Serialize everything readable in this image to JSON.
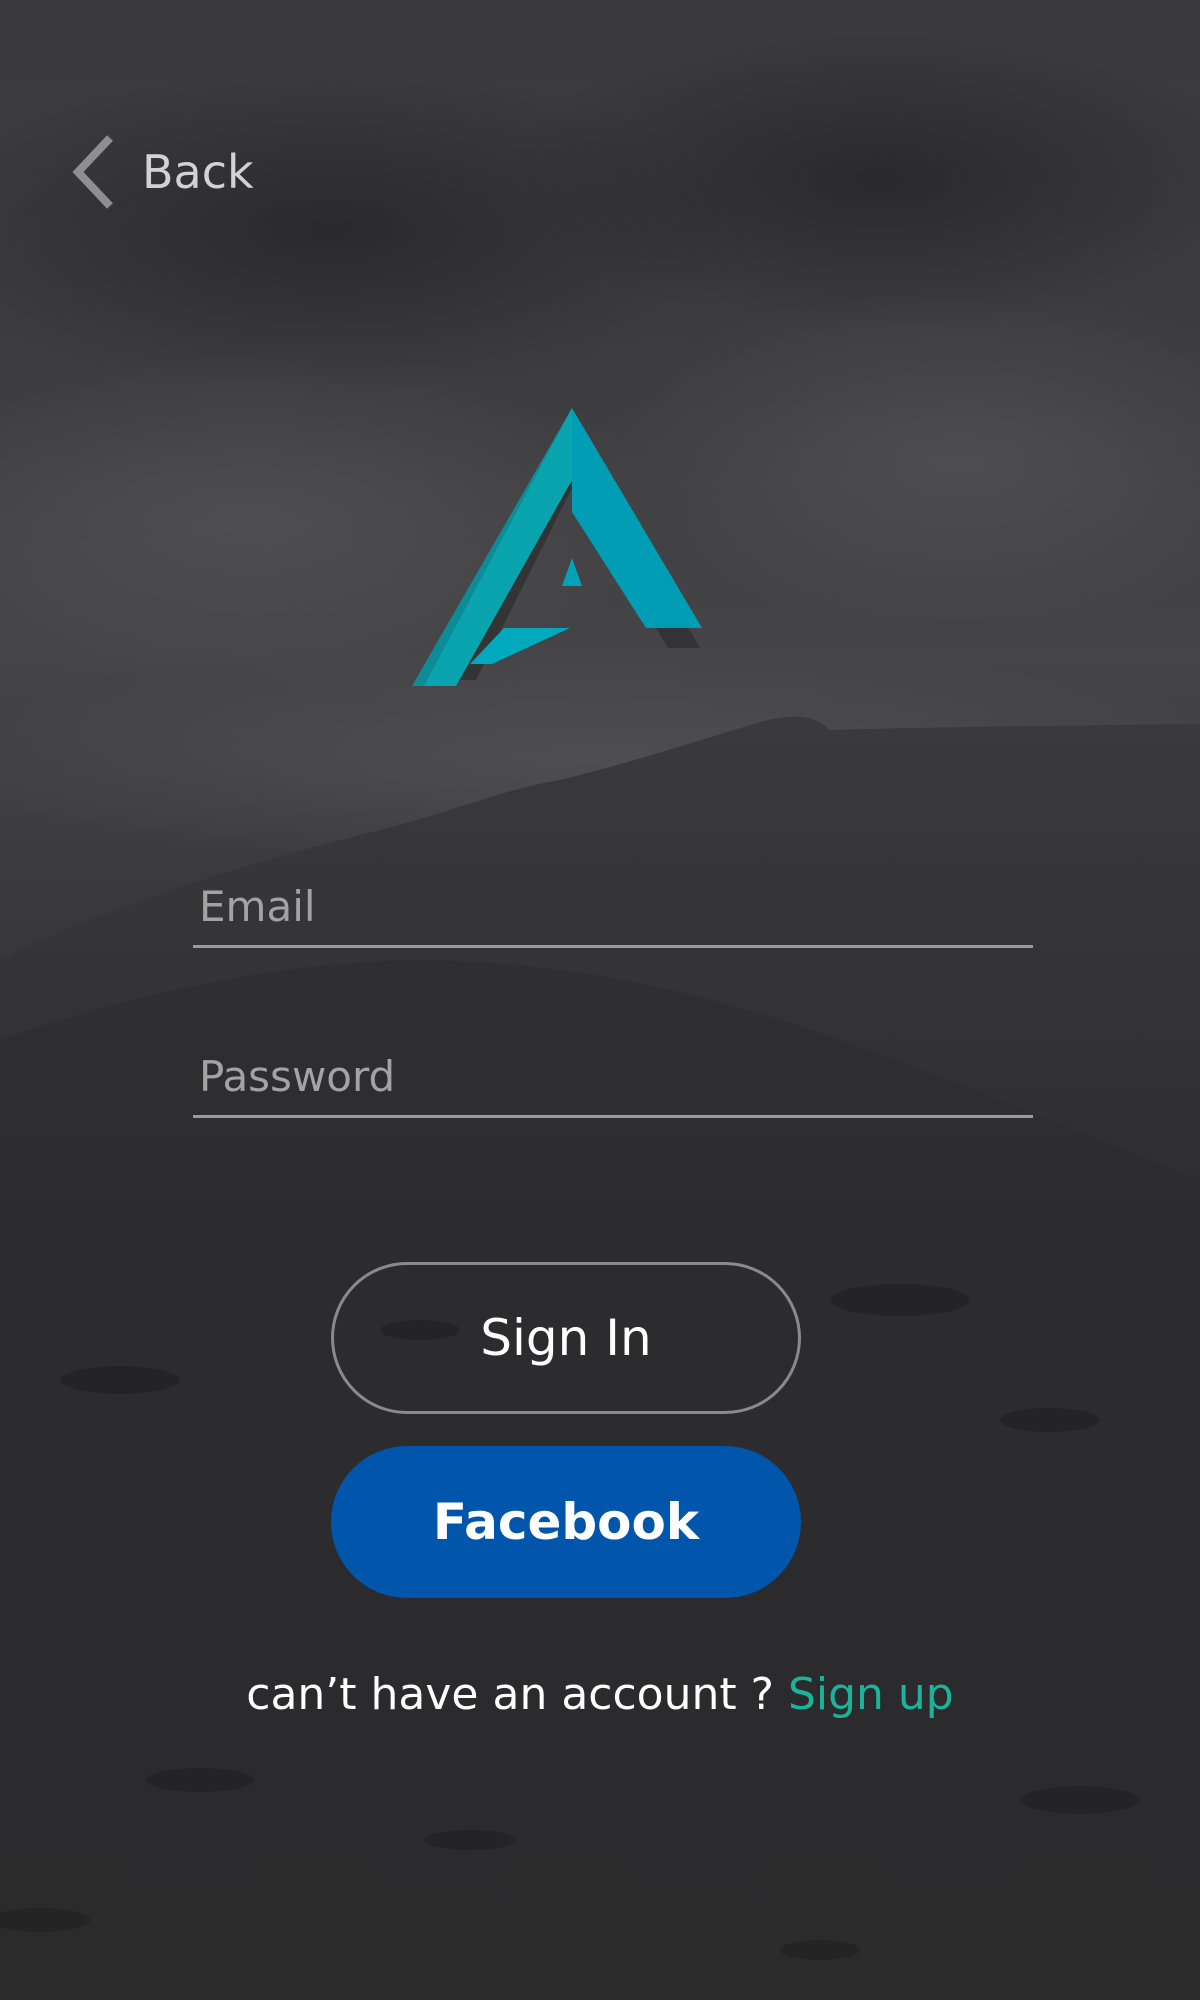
{
  "header": {
    "back_label": "Back",
    "back_icon": "chevron-left-icon"
  },
  "logo": {
    "icon": "triangle-a-logo",
    "colors": {
      "primary": "#009db5",
      "dark": "#0d8c97",
      "shadow": "#2c2c2e"
    }
  },
  "form": {
    "email": {
      "placeholder": "Email",
      "value": ""
    },
    "password": {
      "placeholder": "Password",
      "value": ""
    }
  },
  "actions": {
    "signin_label": "Sign In",
    "facebook_label": "Facebook"
  },
  "footer": {
    "prompt": "can’t have an account ?",
    "signup_label": "Sign up"
  },
  "colors": {
    "accent_teal": "#1bb49a",
    "facebook_blue": "#0155ab",
    "logo_cyan": "#009db5"
  }
}
